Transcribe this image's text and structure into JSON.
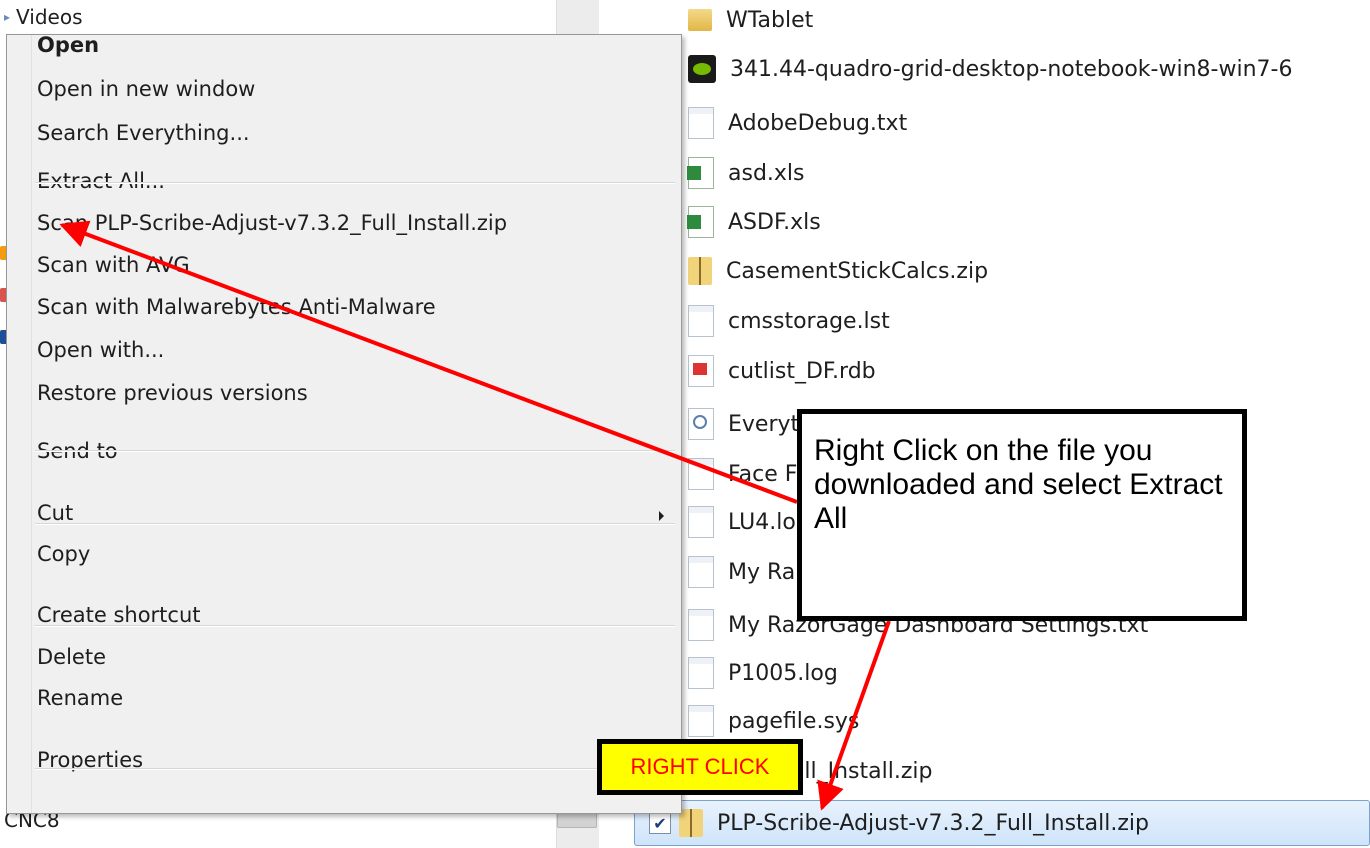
{
  "left_pane": {
    "top_item": "Videos",
    "bottom_item": "CNC8"
  },
  "context_menu": {
    "items": [
      {
        "label": "Open",
        "bold": true
      },
      {
        "label": "Open in new window"
      },
      {
        "label": "Search Everything..."
      },
      {
        "label": "Extract All..."
      },
      {
        "label": "Scan PLP-Scribe-Adjust-v7.3.2_Full_Install.zip"
      },
      {
        "label": "Scan with AVG"
      },
      {
        "label": "Scan with Malwarebytes Anti-Malware"
      },
      {
        "label": "Open with..."
      },
      {
        "label": "Restore previous versions"
      },
      {
        "label": "Send to"
      },
      {
        "label": "Cut"
      },
      {
        "label": "Copy"
      },
      {
        "label": "Create shortcut"
      },
      {
        "label": "Delete"
      },
      {
        "label": "Rename"
      },
      {
        "label": "Properties"
      }
    ]
  },
  "file_list": {
    "files": [
      {
        "name": "WTablet",
        "icon": "folder-icon"
      },
      {
        "name": "341.44-quadro-grid-desktop-notebook-win8-win7-6",
        "icon": "nvidia-installer-icon"
      },
      {
        "name": "AdobeDebug.txt",
        "icon": "text-file-icon"
      },
      {
        "name": "asd.xls",
        "icon": "excel-file-icon"
      },
      {
        "name": "ASDF.xls",
        "icon": "excel-file-icon"
      },
      {
        "name": "CasementStickCalcs.zip",
        "icon": "zip-folder-icon"
      },
      {
        "name": "cmsstorage.lst",
        "icon": "blank-file-icon"
      },
      {
        "name": "cutlist_DF.rdb",
        "icon": "rdb-file-icon"
      },
      {
        "name": "Everyt",
        "icon": "search-file-icon"
      },
      {
        "name": "Face F",
        "icon": "text-file-icon"
      },
      {
        "name": "LU4.lo",
        "icon": "text-file-icon"
      },
      {
        "name": "My Ra",
        "icon": "text-file-icon"
      },
      {
        "name": "My RazorGage Dashboard Settings.txt",
        "icon": "text-file-icon"
      },
      {
        "name": "P1005.log",
        "icon": "text-file-icon"
      },
      {
        "name": "pagefile.sys",
        "icon": "system-file-icon"
      },
      {
        "name": ".3.0_Full_Install.zip",
        "icon": "zip-folder-icon"
      }
    ],
    "selected_file": {
      "name": "PLP-Scribe-Adjust-v7.3.2_Full_Install.zip",
      "checked": true,
      "checkmark": "✔"
    }
  },
  "annotations": {
    "callout_text": "Right Click on the file you downloaded and select Extract All",
    "right_click_label": "RIGHT CLICK",
    "arrow_color": "#ff0000"
  }
}
